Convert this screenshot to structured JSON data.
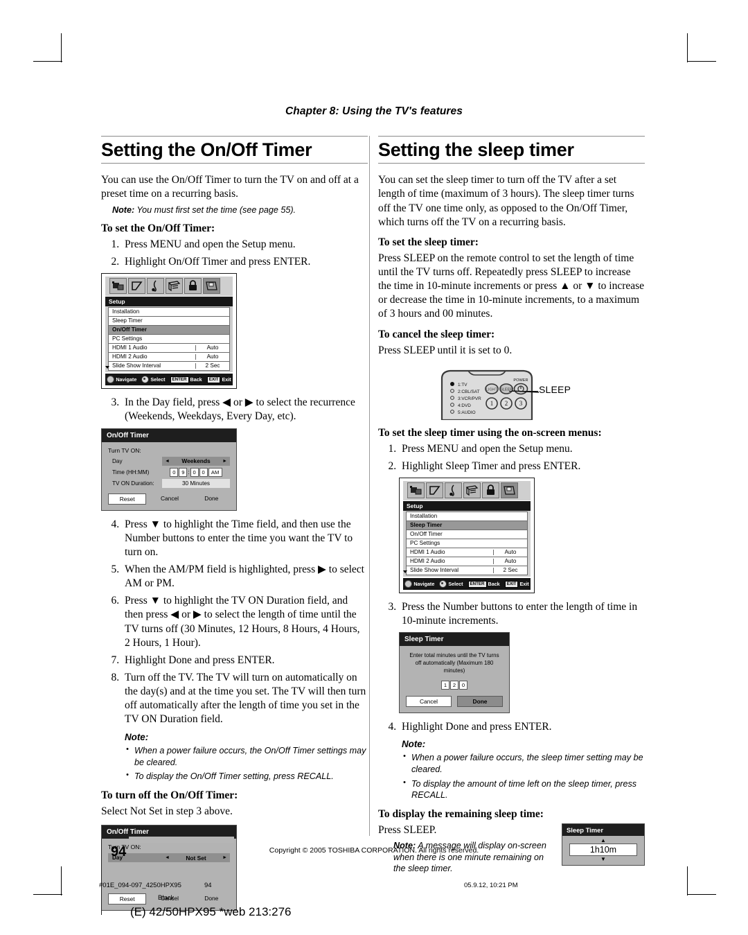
{
  "header": {
    "chapter": "Chapter 8: Using the TV's features"
  },
  "left_column": {
    "title": "Setting the On/Off Timer",
    "intro": "You can use the On/Off Timer to turn the TV on and off at a preset time on a recurring basis.",
    "note_label": "Note:",
    "note_text": " You must first set the time (see page 55).",
    "subhead_set": "To set the On/Off Timer:",
    "steps_1_2": [
      "Press MENU and open the Setup menu.",
      "Highlight On/Off Timer and press ENTER."
    ],
    "step_3": "In the Day field, press ◀ or ▶ to select the recurrence (Weekends, Weekdays, Every Day, etc).",
    "steps_4_8": [
      "Press ▼ to highlight the Time field, and then use the Number buttons to enter the time you want the TV to turn on.",
      "When the AM/PM field is highlighted, press ▶ to select AM or PM.",
      "Press ▼ to highlight the TV ON Duration field, and then press ◀ or ▶ to select the length of time until the TV turns off (30 Minutes, 12 Hours, 8 Hours, 4 Hours, 2 Hours, 1 Hour).",
      "Highlight Done and press ENTER.",
      "Turn off the TV. The TV will turn on automatically on the day(s) and at the time you set. The TV will then turn off automatically after the length of time you set in the TV ON Duration field."
    ],
    "note_head": "Note:",
    "note_bullets": [
      "When a power failure occurs, the On/Off Timer settings may be cleared.",
      "To display the On/Off Timer setting, press RECALL."
    ],
    "subhead_turnoff": "To turn off the On/Off Timer:",
    "turnoff_text": "Select Not Set in step 3 above."
  },
  "right_column": {
    "title": "Setting the sleep timer",
    "intro": "You can set the sleep timer to turn off the TV after a set length of time (maximum of 3 hours). The sleep timer turns off the TV one time only, as opposed to the On/Off Timer, which turns off the TV on a recurring basis.",
    "subhead_set": "To set the sleep timer:",
    "set_text": "Press SLEEP on the remote control to set the length of time until the TV turns off. Repeatedly press SLEEP to increase the time in 10-minute increments or press ▲ or ▼ to increase or decrease the time in 10-minute increments, to a maximum of 3 hours and 00 minutes.",
    "subhead_cancel": "To cancel the sleep timer:",
    "cancel_text": "Press SLEEP until it is set to 0.",
    "remote_callout": "SLEEP",
    "subhead_osm": "To set the sleep timer using the on-screen menus:",
    "steps_1_2": [
      "Press MENU and open the Setup menu.",
      "Highlight Sleep Timer and press ENTER."
    ],
    "step_3": "Press the Number buttons to enter the length of time in 10-minute increments.",
    "step_4": "Highlight Done and press ENTER.",
    "note_head": "Note:",
    "note_bullets": [
      "When a power failure occurs, the sleep timer setting may be cleared.",
      "To display the amount of time left on the sleep timer, press RECALL."
    ],
    "subhead_remaining": "To display the remaining sleep time:",
    "remaining_text": "Press SLEEP.",
    "note2_label": "Note:",
    "note2_text": " A message will display on-screen when there is one minute remaining on the sleep timer."
  },
  "osd": {
    "setup_menu_1": {
      "title": "Setup",
      "rows": [
        {
          "label": "Installation",
          "value": "",
          "highlight": false
        },
        {
          "label": "Sleep Timer",
          "value": "",
          "highlight": false
        },
        {
          "label": "On/Off Timer",
          "value": "",
          "highlight": true
        },
        {
          "label": "PC Settings",
          "value": "",
          "highlight": false
        },
        {
          "label": "HDMI 1 Audio",
          "value": "Auto",
          "highlight": false
        },
        {
          "label": "HDMI 2 Audio",
          "value": "Auto",
          "highlight": false
        },
        {
          "label": "Slide Show Interval",
          "value": "2 Sec",
          "highlight": false
        }
      ],
      "footer": [
        {
          "key": "ring",
          "label": "Navigate"
        },
        {
          "key": "dot",
          "label": "Select"
        },
        {
          "key": "ENTER",
          "label": "Back"
        },
        {
          "key": "EXIT",
          "label": "Exit"
        }
      ]
    },
    "setup_menu_2": {
      "title": "Setup",
      "rows": [
        {
          "label": "Installation",
          "value": "",
          "highlight": false
        },
        {
          "label": "Sleep Timer",
          "value": "",
          "highlight": true
        },
        {
          "label": "On/Off Timer",
          "value": "",
          "highlight": false
        },
        {
          "label": "PC Settings",
          "value": "",
          "highlight": false
        },
        {
          "label": "HDMI 1 Audio",
          "value": "Auto",
          "highlight": false
        },
        {
          "label": "HDMI 2 Audio",
          "value": "Auto",
          "highlight": false
        },
        {
          "label": "Slide Show Interval",
          "value": "2 Sec",
          "highlight": false
        }
      ],
      "footer": [
        {
          "key": "ring",
          "label": "Navigate"
        },
        {
          "key": "dot",
          "label": "Select"
        },
        {
          "key": "ENTER",
          "label": "Back"
        },
        {
          "key": "EXIT",
          "label": "Exit"
        }
      ]
    },
    "onoff_timer_full": {
      "title": "On/Off Timer",
      "turn_label": "Turn TV ON:",
      "day_label": "Day",
      "day_value": "Weekends",
      "time_label": "Time (HH:MM)",
      "time_digits": [
        "0",
        "9",
        "0",
        "0"
      ],
      "time_ampm": "AM",
      "duration_label": "TV ON Duration:",
      "duration_value": "30 Minutes",
      "buttons": [
        "Reset",
        "Cancel",
        "Done"
      ]
    },
    "onoff_timer_notset": {
      "title": "On/Off Timer",
      "turn_label": "Turn TV ON:",
      "day_label": "Day",
      "day_value": "Not Set",
      "buttons": [
        "Reset",
        "Cancel",
        "Done"
      ]
    },
    "sleep_timer_dialog": {
      "title": "Sleep Timer",
      "message": "Enter total minutes until the TV turns off automatically (Maximum 180 minutes)",
      "digits": [
        "1",
        "2",
        "0"
      ],
      "buttons": [
        "Cancel",
        "Done"
      ]
    },
    "sleep_recall": {
      "title": "Sleep Timer",
      "value": "1h10m",
      "up_arrow": "▲",
      "down_arrow": "▼"
    }
  },
  "remote": {
    "mode_labels": [
      "1:TV",
      "2:CBL/SAT",
      "3:VCR/PVR",
      "4:DVD",
      "5:AUDIO"
    ],
    "buttons": [
      "LIGHT",
      "SLEEP"
    ],
    "power_label": "POWER",
    "number_buttons": [
      "1",
      "2",
      "3"
    ]
  },
  "footer": {
    "copyright": "Copyright © 2005 TOSHIBA CORPORATION. All rights reserved.",
    "page_number": "94",
    "print_file": "#01E_094-097_4250HPX95",
    "print_page": "94",
    "print_date": "05.9.12, 10:21 PM",
    "print_plate": "Black",
    "web_code": "(E) 42/50HPX95 *web 213:276"
  }
}
